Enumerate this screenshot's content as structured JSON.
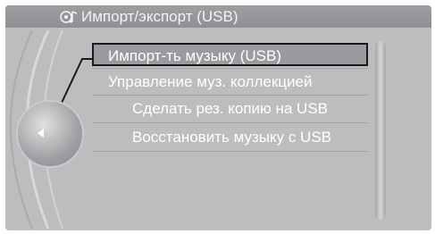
{
  "header": {
    "title": "Импорт/экспорт (USB)",
    "icon": "music-settings-icon"
  },
  "menu": {
    "items": [
      {
        "label": "Импорт-ть музыку (USB)",
        "selected": true
      },
      {
        "label": "Управление муз. коллекцией",
        "selected": false
      },
      {
        "label": "Сделать рез. копию на USB",
        "selected": false
      },
      {
        "label": "Восстановить музыку с USB",
        "selected": false
      }
    ]
  },
  "controller": {
    "icon": "left-arrow-icon"
  },
  "colors": {
    "background": "#bcbdbf",
    "header": "#8e9093",
    "text": "#ffffff",
    "selection_border": "#1a1a1a"
  }
}
